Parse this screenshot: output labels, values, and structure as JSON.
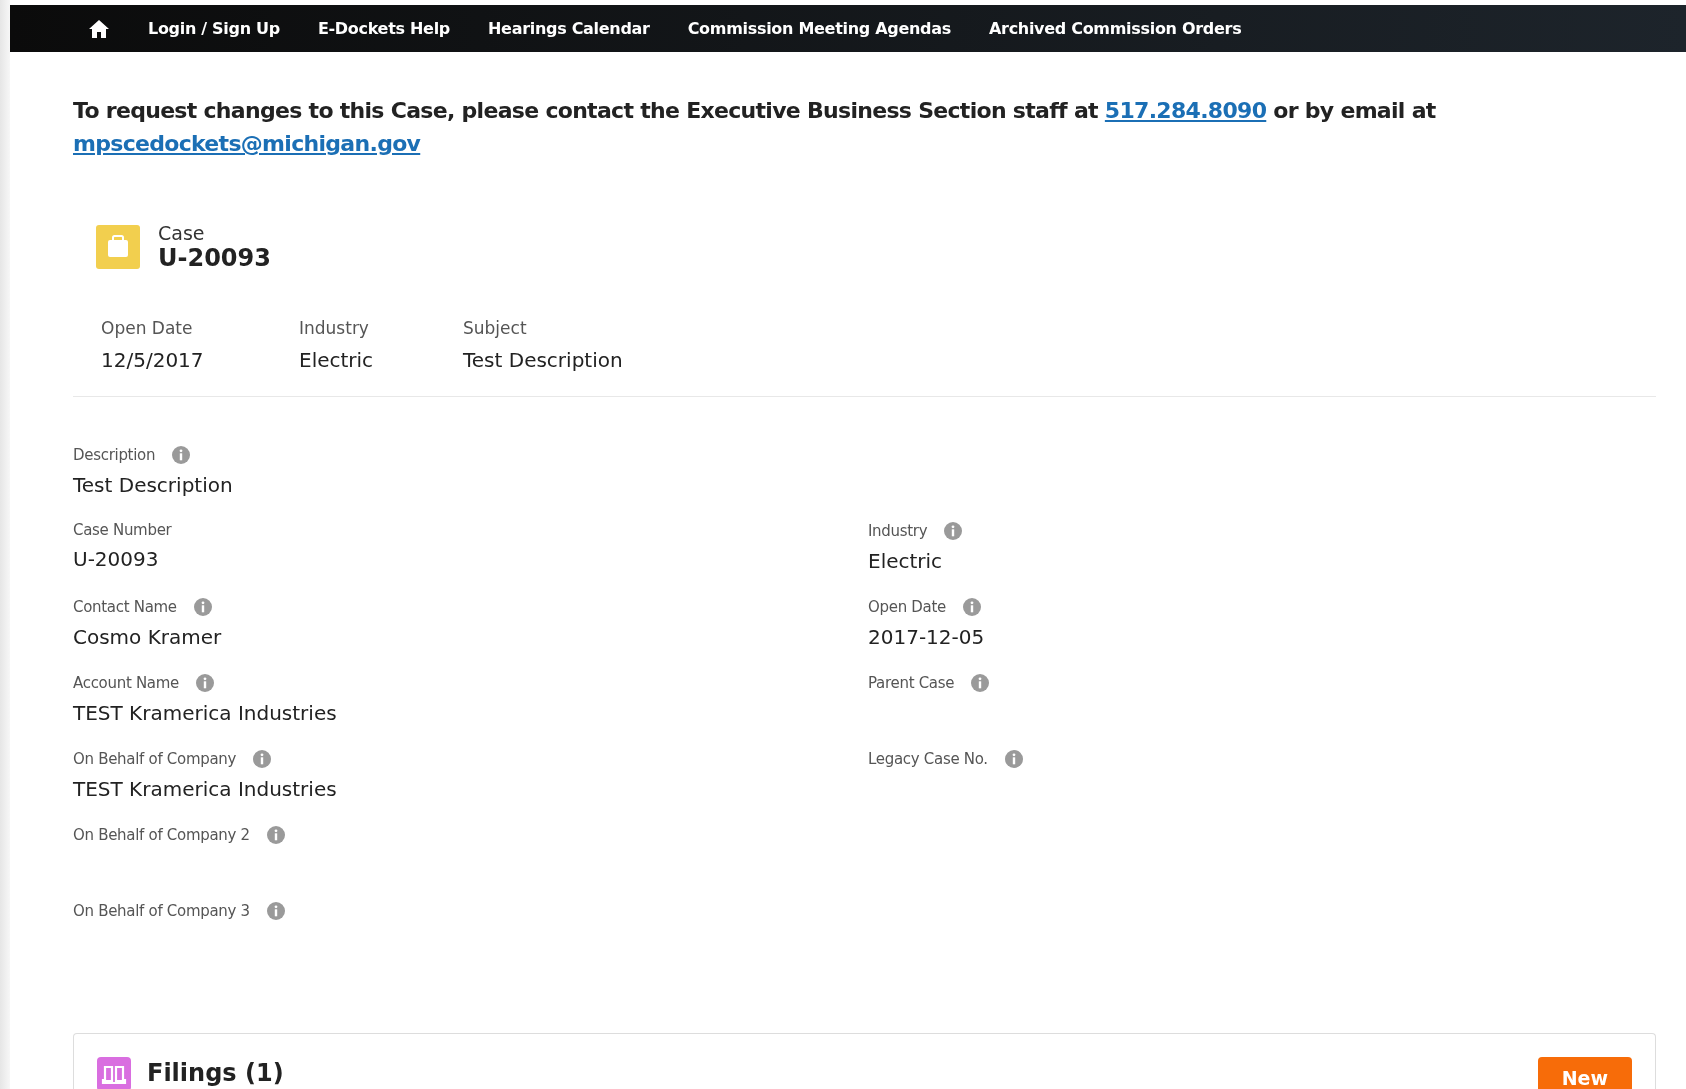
{
  "nav": {
    "items": [
      {
        "label": "Login / Sign Up"
      },
      {
        "label": "E-Dockets Help"
      },
      {
        "label": "Hearings Calendar"
      },
      {
        "label": "Commission Meeting Agendas"
      },
      {
        "label": "Archived Commission Orders"
      }
    ]
  },
  "notice": {
    "before": "To request changes to this Case, please contact the Executive Business Section staff at",
    "phone": "517.284.8090",
    "middle": "or by email at",
    "email": "mpscedockets@michigan.gov"
  },
  "record": {
    "type": "Case",
    "title": "U-20093",
    "highlights": [
      {
        "label": "Open Date",
        "value": "12/5/2017"
      },
      {
        "label": "Industry",
        "value": "Electric"
      },
      {
        "label": "Subject",
        "value": "Test Description"
      }
    ]
  },
  "detail_rows": [
    [
      {
        "label": "Description",
        "info": true,
        "value": "Test Description"
      }
    ],
    [
      {
        "label": "Case Number",
        "info": false,
        "value": "U-20093"
      },
      {
        "label": "Industry",
        "info": true,
        "value": "Electric"
      }
    ],
    [
      {
        "label": "Contact Name",
        "info": true,
        "value": "Cosmo Kramer"
      },
      {
        "label": "Open Date",
        "info": true,
        "value": "2017-12-05"
      }
    ],
    [
      {
        "label": "Account Name",
        "info": true,
        "value": "TEST Kramerica Industries"
      },
      {
        "label": "Parent Case",
        "info": true
      }
    ],
    [
      {
        "label": "On Behalf of Company",
        "info": true,
        "value": "TEST Kramerica Industries"
      },
      {
        "label": "Legacy Case No.",
        "info": true
      }
    ],
    [
      {
        "label": "On Behalf of Company 2",
        "info": true
      }
    ],
    [
      {
        "label": "On Behalf of Company 3",
        "info": true
      }
    ]
  ],
  "related": {
    "title": "Filings (1)",
    "button": "New"
  }
}
